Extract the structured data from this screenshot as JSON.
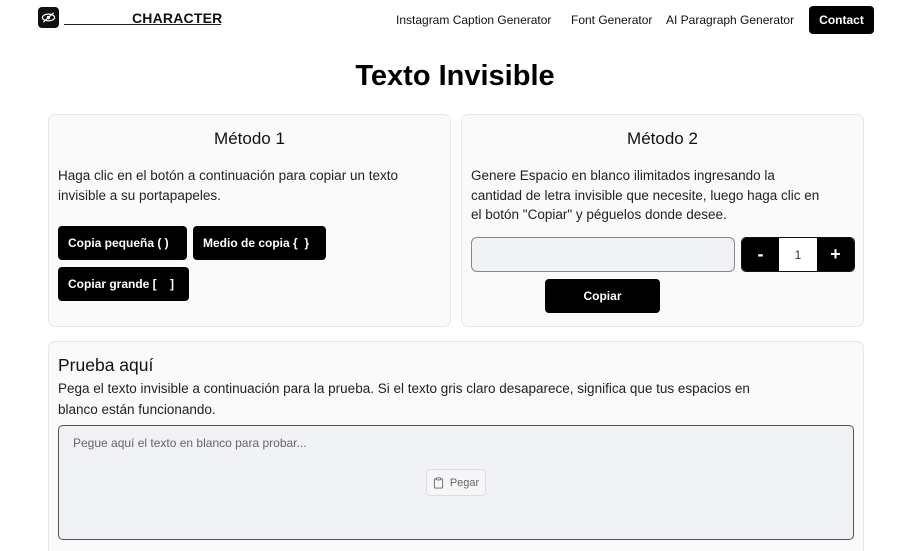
{
  "header": {
    "brand": "CHARACTER",
    "logo_icon": "eye-icon",
    "nav": [
      {
        "label": "Instagram Caption Generator"
      },
      {
        "label": "Font Generator"
      },
      {
        "label": "AI Paragraph Generator"
      }
    ],
    "contact_label": "Contact"
  },
  "page_title": "Texto Invisible",
  "method1": {
    "title": "Método 1",
    "description_line1": "Haga clic en el botón a continuación para copiar un texto",
    "description_line2": "invisible a su portapapeles.",
    "buttons": [
      {
        "label": "Copia pequeña ( )"
      },
      {
        "label": "Medio de copia {  }"
      },
      {
        "label": "Copiar grande [    ]"
      }
    ]
  },
  "method2": {
    "title": "Método 2",
    "description_line1": "Genere Espacio en blanco ilimitados ingresando la",
    "description_line2": "cantidad de letra invisible que necesite, luego haga clic en",
    "description_line3": "el botón \"Copiar\" y péguelos donde desee.",
    "input_value": "",
    "stepper": {
      "minus": "-",
      "value": "1",
      "plus": "+"
    },
    "copy_label": "Copiar"
  },
  "test": {
    "title": "Prueba aquí",
    "description_line1": "Pega el texto invisible a continuación para la prueba. Si el texto gris claro desaparece, significa que tus espacios en",
    "description_line2": "blanco están funcionando.",
    "placeholder": "Pegue aquí el texto en blanco para probar...",
    "paste_label": "Pegar",
    "paste_icon": "clipboard-icon"
  },
  "colors": {
    "accent": "#000000",
    "card_bg": "#fafafa",
    "input_bg": "#f1f2f6"
  }
}
